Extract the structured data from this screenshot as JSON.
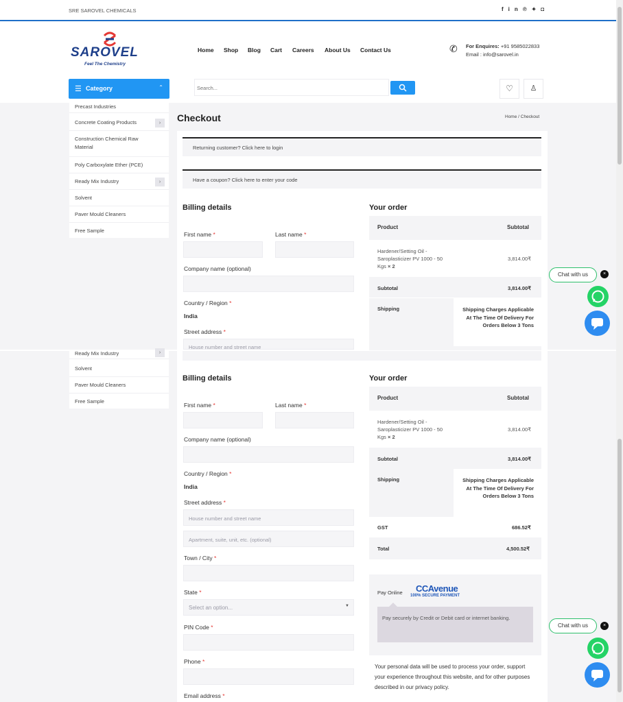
{
  "topbar": {
    "company": "SRE SAROVEL CHEMICALS"
  },
  "logo": {
    "brand": "SAROVEL",
    "tagline": "Feel The Chemistry"
  },
  "nav": [
    "Home",
    "Shop",
    "Blog",
    "Cart",
    "Careers",
    "About Us",
    "Contact Us"
  ],
  "contact": {
    "enquiries_label": "For Enquires:",
    "phone": "+91 9585022833",
    "email": "Email : info@sarovel.in"
  },
  "category": {
    "label": "Category",
    "items": [
      "Precast Industries",
      "Concrete Coating Products",
      "Construction Chemical Raw Material",
      "Poly Carboxylate Ether (PCE)",
      "Ready Mix Industry",
      "Solvent",
      "Paver Mould Cleaners",
      "Free Sample"
    ]
  },
  "search": {
    "placeholder": "Search..."
  },
  "page": {
    "title": "Checkout",
    "breadcrumb_home": "Home",
    "breadcrumb_sep": "/",
    "breadcrumb_current": "Checkout"
  },
  "notices": {
    "login": "Returning customer? Click here to login",
    "coupon": "Have a coupon? Click here to enter your code"
  },
  "billing": {
    "heading": "Billing details",
    "first_name": "First name",
    "last_name": "Last name",
    "company": "Company name (optional)",
    "country_label": "Country / Region",
    "country_value": "India",
    "street_label": "Street address",
    "street_ph": "House number and street name",
    "apt_ph": "Apartment, suite, unit, etc. (optional)",
    "town": "Town / City",
    "state": "State",
    "state_ph": "Select an option...",
    "pin": "PIN Code",
    "phone": "Phone",
    "email": "Email address",
    "req": "*"
  },
  "order": {
    "heading": "Your order",
    "col_product": "Product",
    "col_subtotal": "Subtotal",
    "item_name": "Hardener/Setting Oil - Saroplasticizer PV 1000 - 50 Kgs",
    "item_qty": "× 2",
    "item_total": "3,814.00₹",
    "subtotal_label": "Subtotal",
    "subtotal_value": "3,814.00₹",
    "shipping_label": "Shipping",
    "shipping_value": "Shipping Charges Applicable At The Time Of Delivery For Orders Below 3 Tons",
    "gst_label": "GST",
    "gst_value": "686.52₹",
    "total_label": "Total",
    "total_value": "4,500.52₹"
  },
  "payment": {
    "method": "Pay Online",
    "provider": "CCAvenue",
    "provider_tag": "100% SECURE PAYMENT",
    "desc": "Pay securely by Credit or Debit card or internet banking.",
    "privacy": "Your personal data will be used to process your order, support your experience throughout this website, and for other purposes described in our privacy policy."
  },
  "chat": {
    "label": "Chat with us",
    "close": "×"
  },
  "colors": {
    "accent": "#2196f3",
    "whatsapp": "#25d366",
    "required": "#e53935"
  }
}
